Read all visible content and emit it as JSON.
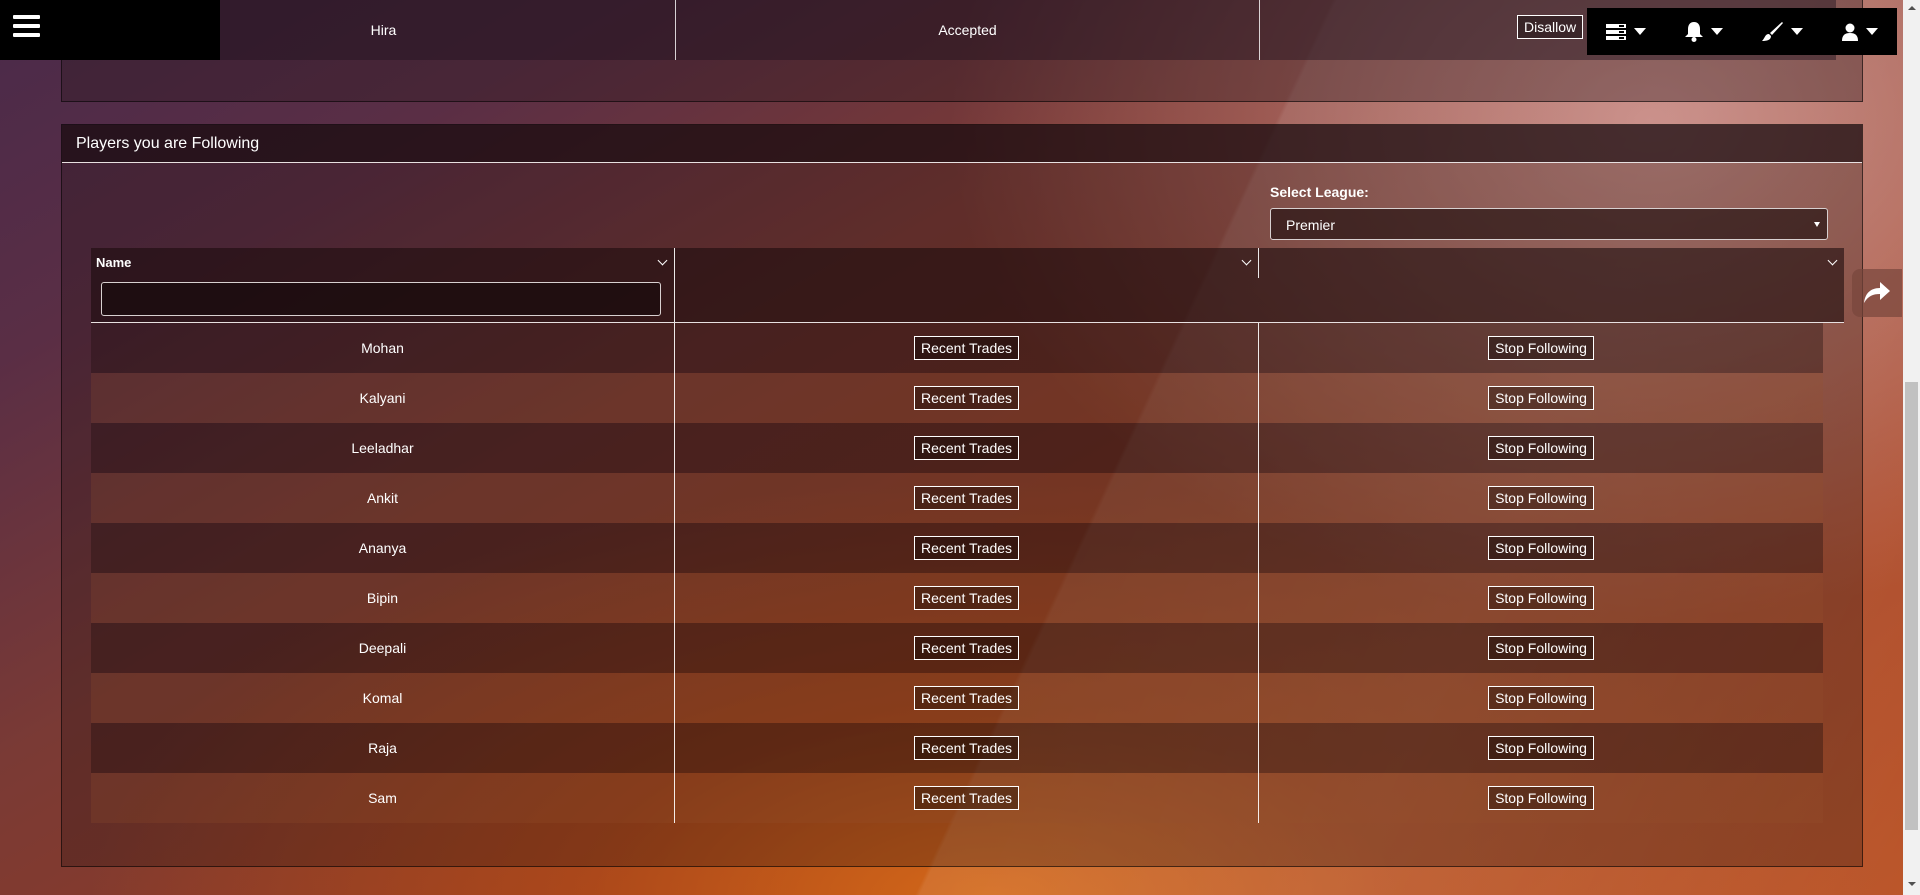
{
  "top_row": {
    "name": "Hira",
    "status": "Accepted",
    "action_label": "Disallow"
  },
  "toolbar": {
    "icons": [
      "list-icon",
      "bell-icon",
      "brush-icon",
      "user-icon"
    ]
  },
  "panel": {
    "title": "Players you are Following",
    "league_label": "Select League:",
    "league_value": "Premier"
  },
  "grid": {
    "columns": [
      "Name",
      "",
      ""
    ],
    "filter_value": "",
    "rows": [
      {
        "name": "Mohan",
        "trades_label": "Recent Trades",
        "stop_label": "Stop Following"
      },
      {
        "name": "Kalyani",
        "trades_label": "Recent Trades",
        "stop_label": "Stop Following"
      },
      {
        "name": "Leeladhar",
        "trades_label": "Recent Trades",
        "stop_label": "Stop Following"
      },
      {
        "name": "Ankit",
        "trades_label": "Recent Trades",
        "stop_label": "Stop Following"
      },
      {
        "name": "Ananya",
        "trades_label": "Recent Trades",
        "stop_label": "Stop Following"
      },
      {
        "name": "Bipin",
        "trades_label": "Recent Trades",
        "stop_label": "Stop Following"
      },
      {
        "name": "Deepali",
        "trades_label": "Recent Trades",
        "stop_label": "Stop Following"
      },
      {
        "name": "Komal",
        "trades_label": "Recent Trades",
        "stop_label": "Stop Following"
      },
      {
        "name": "Raja",
        "trades_label": "Recent Trades",
        "stop_label": "Stop Following"
      },
      {
        "name": "Sam",
        "trades_label": "Recent Trades",
        "stop_label": "Stop Following"
      }
    ]
  }
}
